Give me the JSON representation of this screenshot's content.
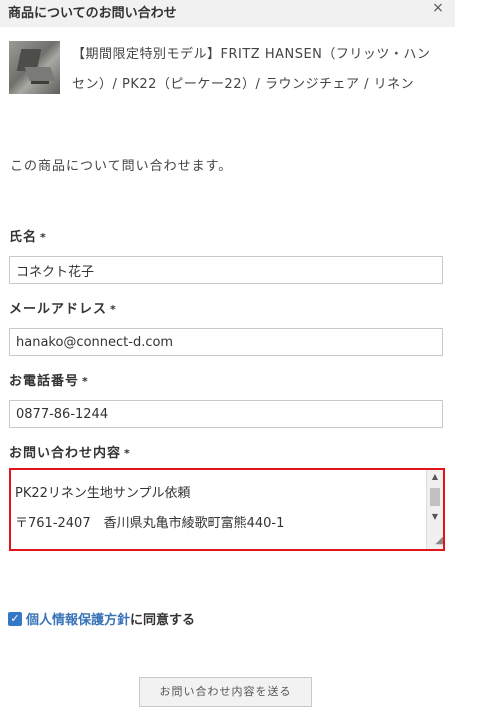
{
  "modal": {
    "title": "商品についてのお問い合わせ",
    "close_label": "×"
  },
  "product": {
    "name": "【期間限定特別モデル】FRITZ HANSEN（フリッツ・ハンセン）/ PK22（ピーケー22）/ ラウンジチェア / リネン"
  },
  "intro_text": "この商品について問い合わせます。",
  "form": {
    "required_mark": "*",
    "name": {
      "label": "氏名",
      "value": "コネクト花子"
    },
    "email": {
      "label": "メールアドレス",
      "value": "hanako@connect-d.com"
    },
    "phone": {
      "label": "お電話番号",
      "value": "0877-86-1244"
    },
    "message": {
      "label": "お問い合わせ内容",
      "lines": [
        "PK22リネン生地サンプル依頼",
        "〒761-2407　香川県丸亀市綾歌町富熊440-1"
      ]
    }
  },
  "agree": {
    "checkmark": "✓",
    "policy_link": "個人情報保護方針",
    "suffix": "に同意する"
  },
  "submit_label": "お問い合わせ内容を送る",
  "colors": {
    "highlight_border": "#e0141a",
    "checkbox": "#3578c8",
    "link": "#3a74b8"
  }
}
